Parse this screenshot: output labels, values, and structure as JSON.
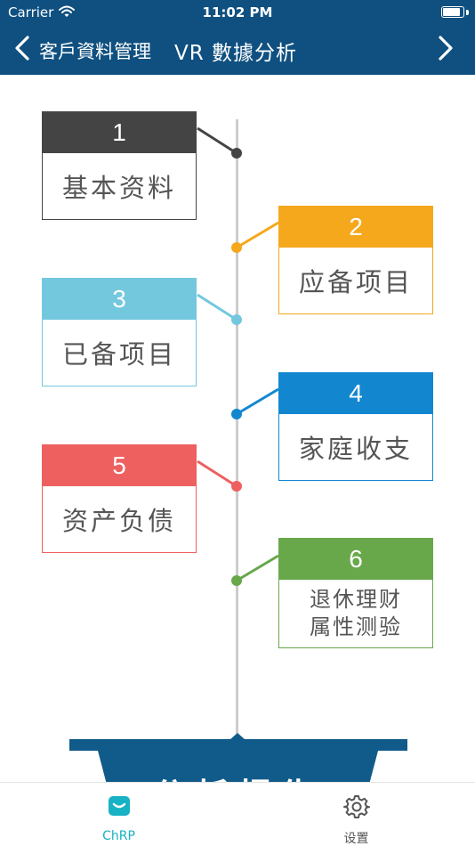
{
  "status_bar": {
    "carrier": "Carrier",
    "time": "11:02 PM",
    "battery_level": 0.9
  },
  "nav": {
    "back_label": "客戶資料管理",
    "title": "VR 數據分析"
  },
  "timeline": {
    "items": [
      {
        "number": "1",
        "label": "基本资料",
        "color": "#444444"
      },
      {
        "number": "2",
        "label": "应备项目",
        "color": "#f5a81c"
      },
      {
        "number": "3",
        "label": "已备项目",
        "color": "#73c8de"
      },
      {
        "number": "4",
        "label": "家庭收支",
        "color": "#1287cf"
      },
      {
        "number": "5",
        "label": "资产负债",
        "color": "#ee6060"
      },
      {
        "number": "6",
        "label_line1": "退休理财",
        "label_line2": "属性测验",
        "color": "#68a84b"
      }
    ]
  },
  "banner": {
    "text": "分析报告"
  },
  "tabbar": {
    "tabs": [
      {
        "label": "ChRP",
        "icon": "chrp-icon",
        "active": true,
        "color": "#17b2c4"
      },
      {
        "label": "设置",
        "icon": "gear-icon",
        "active": false,
        "color": "#555555"
      }
    ]
  }
}
